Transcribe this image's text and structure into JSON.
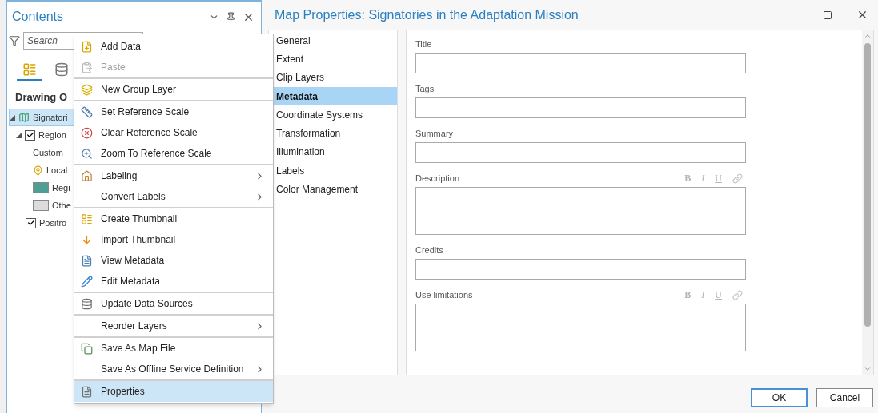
{
  "contents_pane": {
    "title": "Contents",
    "search": {
      "placeholder": "Search"
    },
    "view_tabs": [
      {
        "selected": true
      },
      {
        "selected": false
      }
    ],
    "heading": "Drawing O",
    "tree": [
      {
        "label": "Signatori",
        "kind": "map",
        "selected": true,
        "expanded": true,
        "children": [
          {
            "label": "Region",
            "kind": "layer",
            "checked": true,
            "expanded": true,
            "children": [
              {
                "label": "Custom",
                "kind": "heading"
              },
              {
                "label": "Local",
                "kind": "marker"
              },
              {
                "label": "Regi",
                "kind": "swatch",
                "color": "#4f9e96"
              },
              {
                "label": "Othe",
                "kind": "swatch",
                "color": "#dcdcdc"
              }
            ]
          },
          {
            "label": "Positro",
            "kind": "layer",
            "checked": true
          }
        ]
      }
    ]
  },
  "context_menu": {
    "groups": [
      [
        {
          "label": "Add Data",
          "disabled": false,
          "submenu": false,
          "selected": false
        },
        {
          "label": "Paste",
          "disabled": true,
          "submenu": false,
          "selected": false
        }
      ],
      [
        {
          "label": "New Group Layer",
          "disabled": false,
          "submenu": false,
          "selected": false
        }
      ],
      [
        {
          "label": "Set Reference Scale",
          "disabled": false,
          "submenu": false,
          "selected": false
        },
        {
          "label": "Clear Reference Scale",
          "disabled": false,
          "submenu": false,
          "selected": false
        },
        {
          "label": "Zoom To Reference Scale",
          "disabled": false,
          "submenu": false,
          "selected": false
        }
      ],
      [
        {
          "label": "Labeling",
          "disabled": false,
          "submenu": true,
          "selected": false
        },
        {
          "label": "Convert Labels",
          "disabled": false,
          "submenu": true,
          "selected": false
        }
      ],
      [
        {
          "label": "Create Thumbnail",
          "disabled": false,
          "submenu": false,
          "selected": false
        },
        {
          "label": "Import Thumbnail",
          "disabled": false,
          "submenu": false,
          "selected": false
        },
        {
          "label": "View Metadata",
          "disabled": false,
          "submenu": false,
          "selected": false
        },
        {
          "label": "Edit Metadata",
          "disabled": false,
          "submenu": false,
          "selected": false
        }
      ],
      [
        {
          "label": "Update Data Sources",
          "disabled": false,
          "submenu": false,
          "selected": false
        }
      ],
      [
        {
          "label": "Reorder Layers",
          "disabled": false,
          "submenu": true,
          "selected": false
        }
      ],
      [
        {
          "label": "Save As Map File",
          "disabled": false,
          "submenu": false,
          "selected": false
        },
        {
          "label": "Save As Offline Service Definition",
          "disabled": false,
          "submenu": true,
          "selected": false
        }
      ],
      [
        {
          "label": "Properties",
          "disabled": false,
          "submenu": false,
          "selected": true
        }
      ]
    ]
  },
  "dialog": {
    "title": "Map Properties: Signatories in the Adaptation Mission",
    "nav": [
      {
        "label": "General",
        "selected": false
      },
      {
        "label": "Extent",
        "selected": false
      },
      {
        "label": "Clip Layers",
        "selected": false
      },
      {
        "label": "Metadata",
        "selected": true
      },
      {
        "label": "Coordinate Systems",
        "selected": false
      },
      {
        "label": "Transformation",
        "selected": false
      },
      {
        "label": "Illumination",
        "selected": false
      },
      {
        "label": "Labels",
        "selected": false
      },
      {
        "label": "Color Management",
        "selected": false
      }
    ],
    "fields": [
      {
        "label": "Title",
        "kind": "line"
      },
      {
        "label": "Tags",
        "kind": "line"
      },
      {
        "label": "Summary",
        "kind": "line"
      },
      {
        "label": "Description",
        "kind": "rich",
        "toolbar": [
          "B",
          "I",
          "U"
        ]
      },
      {
        "label": "Credits",
        "kind": "line"
      },
      {
        "label": "Use limitations",
        "kind": "rich",
        "toolbar": [
          "B",
          "I",
          "U"
        ]
      }
    ],
    "buttons": [
      {
        "label": "OK",
        "default": true
      },
      {
        "label": "Cancel",
        "default": false
      }
    ]
  }
}
